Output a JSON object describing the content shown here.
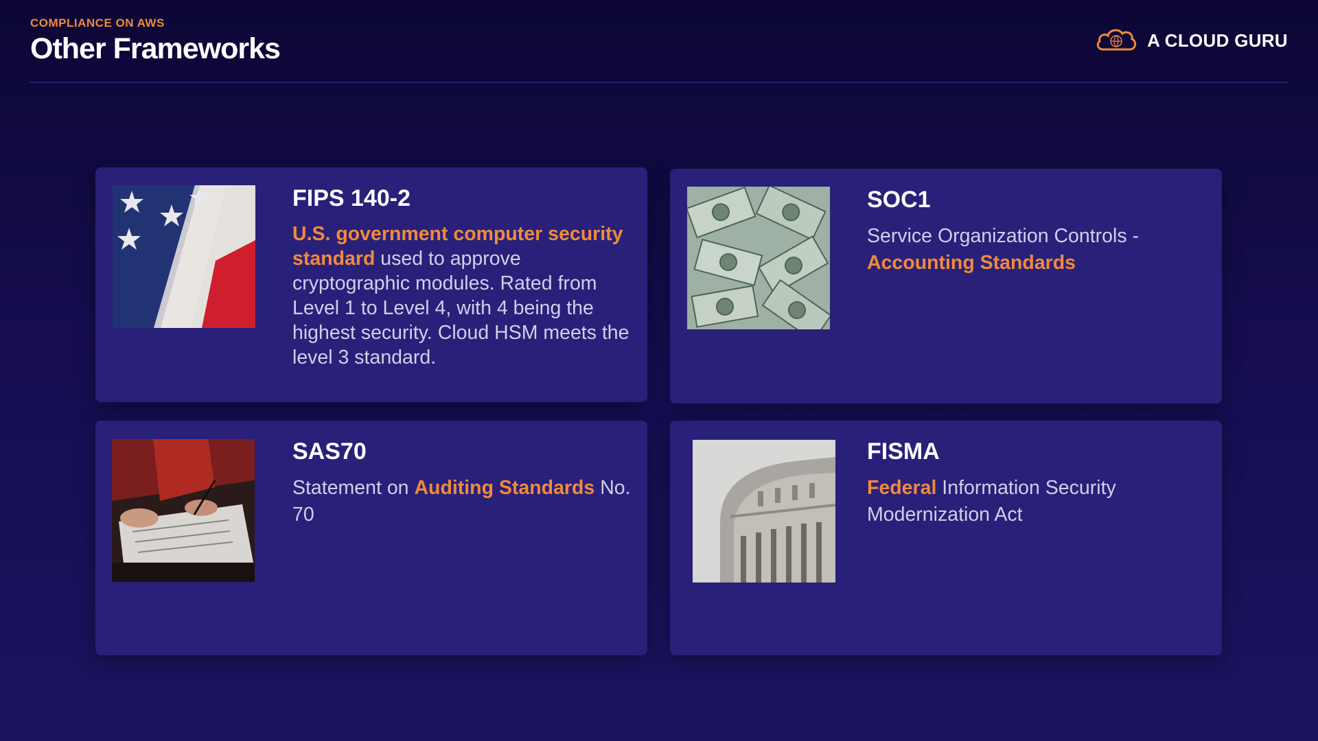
{
  "header": {
    "eyebrow": "COMPLIANCE ON AWS",
    "title": "Other Frameworks"
  },
  "brand": {
    "name": "A CLOUD GURU",
    "icon": "cloud-logo-icon",
    "accent_color": "#f08a3c"
  },
  "cards": [
    {
      "title": "FIPS 140-2",
      "image": "us-flag",
      "desc_highlight": "U.S. government computer security standard",
      "desc_rest": " used to approve cryptographic modules. Rated from Level 1 to Level 4, with 4 being the highest security. Cloud HSM meets the level 3 standard."
    },
    {
      "title": "SOC1",
      "image": "dollar-bills",
      "desc_pre": "Service Organization Controls - ",
      "desc_highlight": "Accounting Standards"
    },
    {
      "title": "SAS70",
      "image": "signing-documents",
      "desc_pre": "Statement on ",
      "desc_highlight": "Auditing Standards",
      "desc_post": " No. 70"
    },
    {
      "title": "FISMA",
      "image": "capitol-dome",
      "desc_highlight": "Federal",
      "desc_rest": " Information Security Modernization Act"
    }
  ],
  "colors": {
    "background": "#150d4f",
    "card": "#29207a",
    "highlight": "#f08a3c",
    "text": "#d3cfe8"
  }
}
